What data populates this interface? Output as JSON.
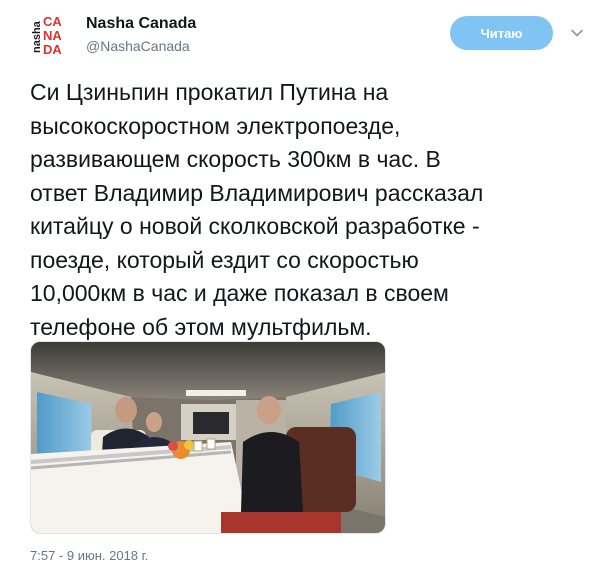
{
  "account": {
    "name": "Nasha Canada",
    "handle": "@NashaCanada",
    "avatar_vertical": "nasha",
    "avatar_letters": [
      "CA",
      "NA",
      "DA"
    ]
  },
  "follow_label": "Читаю",
  "tweet": {
    "text": "Си Цзиньпин прокатил Путина на\nвысокоскоростном электропоезде,\nразвивающем скорость 300км в час. В\nответ Владимир Владимирович рассказал\nкитайцу о новой сколковской разработке -\nпоезде, который ездит со скоростью\n10,000км в час и даже показал в своем\nтелефоне об этом мультфильм.",
    "timestamp": "7:57 - 9 июн. 2018 г."
  },
  "colors": {
    "follow_button": "#7fc4f3",
    "brand_red": "#e0312b",
    "muted": "#657786"
  }
}
